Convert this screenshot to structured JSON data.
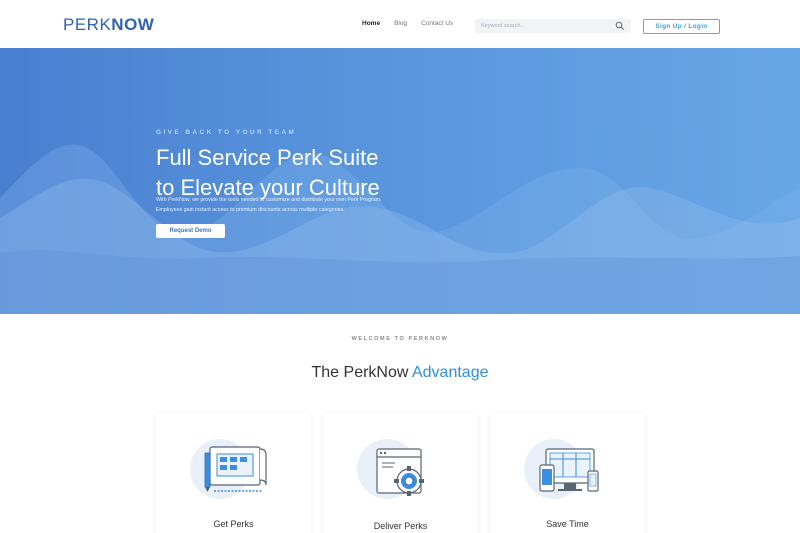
{
  "header": {
    "logo_part1": "PERK",
    "logo_part2": "NOW",
    "nav": {
      "home": "Home",
      "blog": "Blog",
      "contact": "Contact Us"
    },
    "search_placeholder": "Keyword search...",
    "signup_label": "Sign Up / Login"
  },
  "hero": {
    "tagline": "GIVE BACK TO YOUR TEAM",
    "title_line1": "Full Service Perk Suite",
    "title_line2": "to Elevate your Culture",
    "description": "With PerkNow, we provide the tools needed to customize and distribute your own Perk Program. Employees gain instant access to premium discounts across multiple categories.",
    "cta_label": "Request Demo"
  },
  "advantage": {
    "eyebrow": "WELCOME TO PERKNOW",
    "title_prefix": "The PerkNow",
    "title_accent": "Advantage"
  },
  "cards": [
    {
      "label": "Get Perks",
      "icon": "blueprint-icon"
    },
    {
      "label": "Deliver Perks",
      "icon": "browser-gear-icon"
    },
    {
      "label": "Save Time",
      "icon": "devices-icon"
    }
  ],
  "colors": {
    "brand": "#2f63b3",
    "accent": "#2f8fd8",
    "hero_start": "#4a7fd0",
    "hero_end": "#67a6e6",
    "button_border": "#3fb5e8"
  }
}
